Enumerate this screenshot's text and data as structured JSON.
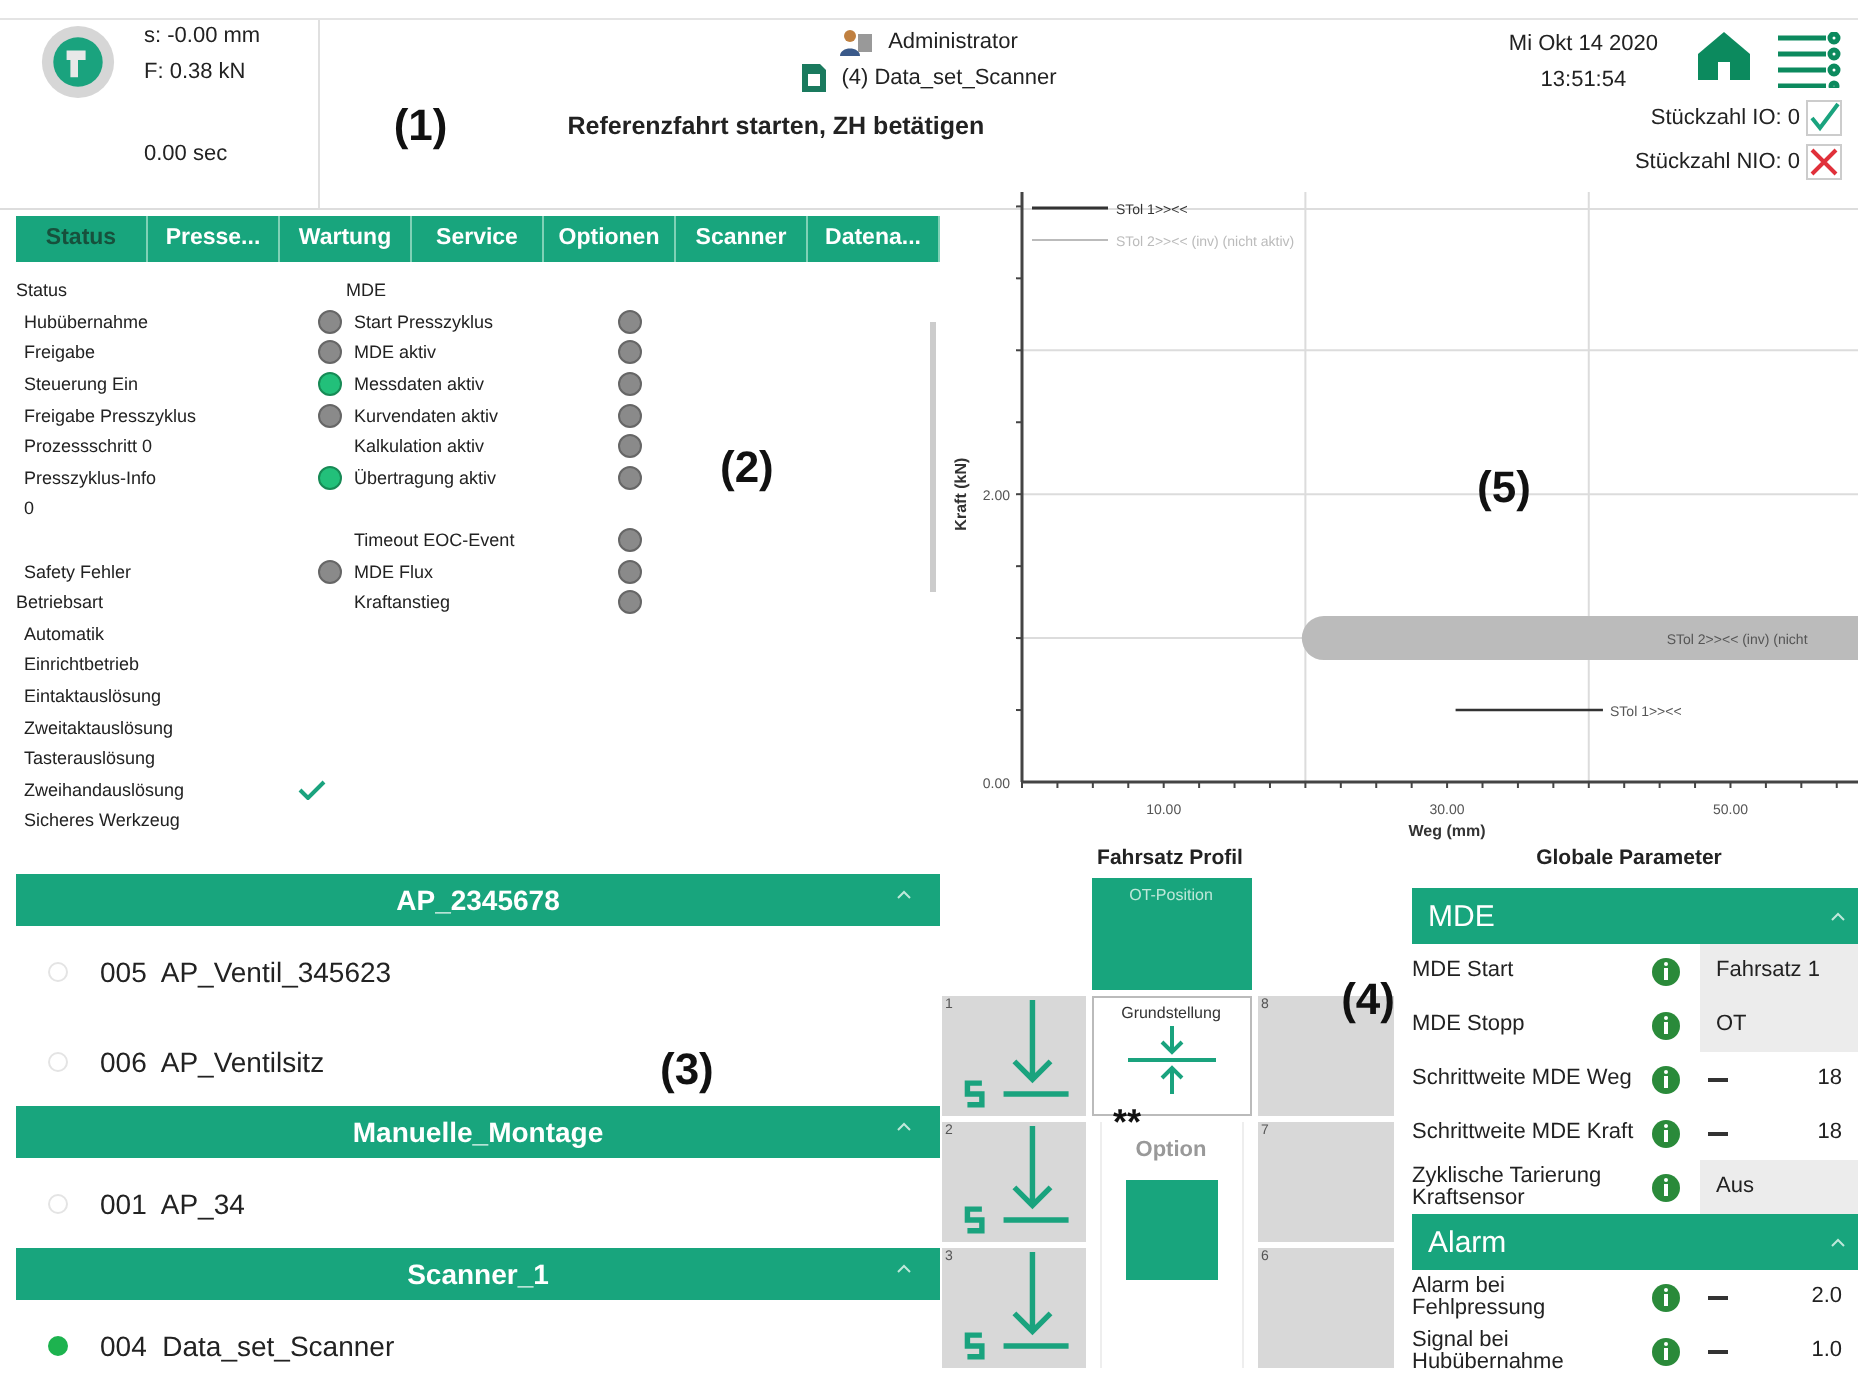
{
  "header": {
    "stroke": "s: -0.00 mm",
    "force": "F: 0.38 kN",
    "time": "0.00 sec",
    "user": "Administrator",
    "dataset": "(4) Data_set_Scanner",
    "message": "Referenzfahrt starten, ZH betätigen",
    "date": "Mi Okt 14 2020",
    "clock": "13:51:54",
    "count_ok": "Stückzahl IO: 0",
    "count_nok": "Stückzahl NIO: 0"
  },
  "annotations": [
    "(1)",
    "(2)",
    "(3)",
    "(4)",
    "(5)",
    "**"
  ],
  "tabs": [
    {
      "label": "Status",
      "selected": true
    },
    {
      "label": "Presse...",
      "selected": false
    },
    {
      "label": "Wartung",
      "selected": false
    },
    {
      "label": "Service",
      "selected": false
    },
    {
      "label": "Optionen",
      "selected": false
    },
    {
      "label": "Scanner",
      "selected": false
    },
    {
      "label": "Datena...",
      "selected": false
    }
  ],
  "status_columns": [
    [
      {
        "kind": "heading",
        "label": "Status"
      },
      {
        "kind": "led",
        "label": "Hubübernahme",
        "on": false
      },
      {
        "kind": "led",
        "label": "Freigabe",
        "on": false
      },
      {
        "kind": "led",
        "label": "Steuerung Ein",
        "on": true
      },
      {
        "kind": "led",
        "label": "Freigabe Presszyklus",
        "on": false
      },
      {
        "kind": "text",
        "label": "Prozessschritt 0"
      },
      {
        "kind": "led",
        "label": "Presszyklus-Info",
        "on": true
      },
      {
        "kind": "text",
        "label": "0"
      },
      {
        "kind": "gap"
      },
      {
        "kind": "led",
        "label": "Safety Fehler",
        "on": false
      },
      {
        "kind": "heading",
        "label": "Betriebsart"
      },
      {
        "kind": "option",
        "label": "Automatik",
        "checked": false
      },
      {
        "kind": "option",
        "label": "Einrichtbetrieb",
        "checked": false
      },
      {
        "kind": "option",
        "label": "Eintaktauslösung",
        "checked": false
      },
      {
        "kind": "option",
        "label": "Zweitaktauslösung",
        "checked": false
      },
      {
        "kind": "option",
        "label": "Tasterauslösung",
        "checked": false
      },
      {
        "kind": "option",
        "label": "Zweihandauslösung",
        "checked": true
      },
      {
        "kind": "option",
        "label": "Sicheres Werkzeug",
        "checked": false
      }
    ],
    [
      {
        "kind": "heading",
        "label": "MDE"
      },
      {
        "kind": "led",
        "label": "Start Presszyklus",
        "on": false
      },
      {
        "kind": "led",
        "label": "MDE aktiv",
        "on": false
      },
      {
        "kind": "led",
        "label": "Messdaten aktiv",
        "on": false
      },
      {
        "kind": "led",
        "label": "Kurvendaten aktiv",
        "on": false
      },
      {
        "kind": "led",
        "label": "Kalkulation aktiv",
        "on": false
      },
      {
        "kind": "led",
        "label": "Übertragung aktiv",
        "on": false
      },
      {
        "kind": "gap"
      },
      {
        "kind": "led",
        "label": "Timeout EOC-Event",
        "on": false
      },
      {
        "kind": "led",
        "label": "MDE Flux",
        "on": false
      },
      {
        "kind": "led",
        "label": "Kraftanstieg",
        "on": false
      }
    ]
  ],
  "chart": {
    "chart_data": {
      "type": "line",
      "xlabel": "Weg (mm)",
      "ylabel": "Kraft (kN)",
      "xlim": [
        0,
        59
      ],
      "ylim": [
        0,
        4.1
      ],
      "xticks": [
        {
          "value": 10,
          "label": "10.00"
        },
        {
          "value": 30,
          "label": "30.00"
        },
        {
          "value": 50,
          "label": "50.00"
        }
      ],
      "yticks": [
        {
          "value": 0,
          "label": "0.00"
        },
        {
          "value": 2,
          "label": "2.00"
        }
      ],
      "series": [
        {
          "name": "STol 1>><<",
          "color": "#333333",
          "x": [
            30.6,
            41
          ],
          "values": [
            0.5,
            0.5
          ]
        },
        {
          "name": "STol 2>><< (inv) (nicht aktiv)",
          "color": "#bbbbbb",
          "x": [
            21.3,
            59
          ],
          "values": [
            1.0,
            1.0
          ]
        }
      ],
      "annotations": [
        "STol 2>><< (inv) (nicht",
        "STol 1>><<"
      ]
    }
  },
  "recipes": [
    {
      "title": "AP_2345678",
      "items": [
        {
          "label": "005  AP_Ventil_345623",
          "selected": false
        },
        {
          "label": "006  AP_Ventilsitz",
          "selected": false
        }
      ]
    },
    {
      "title": "Manuelle_Montage",
      "items": [
        {
          "label": "001  AP_34",
          "selected": false
        }
      ]
    },
    {
      "title": "Scanner_1",
      "items": [
        {
          "label": "004  Data_set_Scanner",
          "selected": true
        }
      ]
    }
  ],
  "profile": {
    "title": "Fahrsatz Profil",
    "top": {
      "label": "OT-Position",
      "selected": true
    },
    "left": [
      {
        "number": "1",
        "kind": "press"
      },
      {
        "number": "2",
        "kind": "press"
      },
      {
        "number": "3",
        "kind": "press"
      }
    ],
    "home": {
      "label": "Grundstellung"
    },
    "option": {
      "label": "Option"
    },
    "right": [
      {
        "number": "8"
      },
      {
        "number": "7"
      },
      {
        "number": "6"
      }
    ]
  },
  "parameters": {
    "title": "Globale Parameter",
    "sections": [
      {
        "title": "MDE",
        "rows": [
          {
            "label": "MDE Start",
            "kind": "select",
            "value": "Fahrsatz 1"
          },
          {
            "label": "MDE Stopp",
            "kind": "select",
            "value": "OT"
          },
          {
            "label": "Schrittweite MDE Weg",
            "kind": "stepper",
            "value": "18"
          },
          {
            "label": "Schrittweite MDE Kraft",
            "kind": "stepper",
            "value": "18"
          },
          {
            "label": "Zyklische Tarierung Kraftsensor",
            "kind": "select",
            "value": "Aus"
          }
        ]
      },
      {
        "title": "Alarm",
        "rows": [
          {
            "label": "Alarm bei Fehlpressung",
            "kind": "stepper",
            "value": "2.0"
          },
          {
            "label": "Signal bei Hubübernahme",
            "kind": "stepper",
            "value": "1.0"
          }
        ]
      }
    ]
  }
}
